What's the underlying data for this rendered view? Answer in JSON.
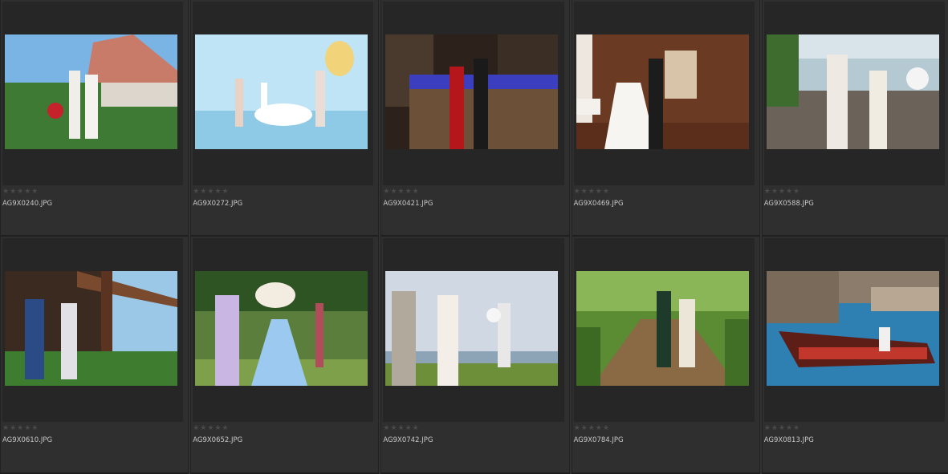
{
  "grid": {
    "items": [
      {
        "filename": "AG9X0240.JPG",
        "rating": "★★★★★",
        "scene": "couple-rooftop"
      },
      {
        "filename": "AG9X0272.JPG",
        "rating": "★★★★★",
        "scene": "couple-beach-swan"
      },
      {
        "filename": "AG9X0421.JPG",
        "rating": "★★★★★",
        "scene": "couple-night-hotel"
      },
      {
        "filename": "AG9X0469.JPG",
        "rating": "★★★★★",
        "scene": "couple-wooden-hall"
      },
      {
        "filename": "AG9X0588.JPG",
        "rating": "★★★★★",
        "scene": "couple-rocks-sea"
      },
      {
        "filename": "AG9X0610.JPG",
        "rating": "★★★★★",
        "scene": "couple-balcony"
      },
      {
        "filename": "AG9X0652.JPG",
        "rating": "★★★★★",
        "scene": "couple-garden"
      },
      {
        "filename": "AG9X0742.JPG",
        "rating": "★★★★★",
        "scene": "couple-walking-sea"
      },
      {
        "filename": "AG9X0784.JPG",
        "rating": "★★★★★",
        "scene": "couple-rope-bridge"
      },
      {
        "filename": "AG9X0813.JPG",
        "rating": "★★★★★",
        "scene": "couple-gondola"
      }
    ]
  },
  "colors": {
    "background": "#323232",
    "frame": "#262626",
    "text": "#c8c8c8",
    "star_empty": "#4a4a4a"
  }
}
